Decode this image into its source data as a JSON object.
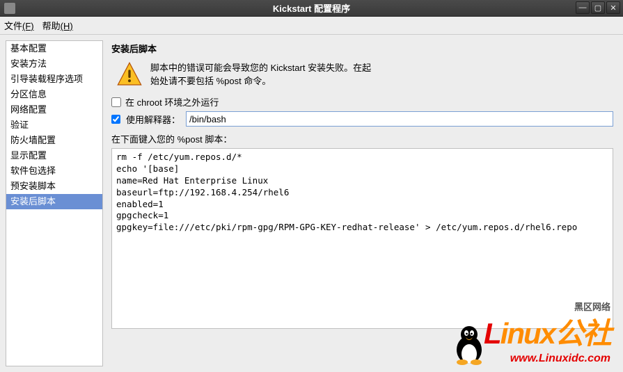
{
  "window": {
    "title": "Kickstart 配置程序"
  },
  "menubar": {
    "file": "文件",
    "file_key": "(F)",
    "help": "帮助",
    "help_key": "(H)"
  },
  "sidebar": {
    "items": [
      {
        "label": "基本配置",
        "selected": false
      },
      {
        "label": "安装方法",
        "selected": false
      },
      {
        "label": "引导装载程序选项",
        "selected": false
      },
      {
        "label": "分区信息",
        "selected": false
      },
      {
        "label": "网络配置",
        "selected": false
      },
      {
        "label": "验证",
        "selected": false
      },
      {
        "label": "防火墙配置",
        "selected": false
      },
      {
        "label": "显示配置",
        "selected": false
      },
      {
        "label": "软件包选择",
        "selected": false
      },
      {
        "label": "预安装脚本",
        "selected": false
      },
      {
        "label": "安装后脚本",
        "selected": true
      }
    ]
  },
  "main": {
    "heading": "安装后脚本",
    "warning_line1": "脚本中的错误可能会导致您的   Kickstart   安装失败。在起",
    "warning_line2": "始处请不要包括  %post 命令。",
    "chroot_label": "在 chroot 环境之外运行",
    "chroot_checked": false,
    "interpreter_label": "使用解释器：",
    "interpreter_checked": true,
    "interpreter_value": "/bin/bash",
    "script_label": "在下面键入您的 %post 脚本：",
    "script_value": "rm -f /etc/yum.repos.d/*\necho '[base]\nname=Red Hat Enterprise Linux\nbaseurl=ftp://192.168.4.254/rhel6\nenabled=1\ngpgcheck=1\ngpgkey=file:///etc/pki/rpm-gpg/RPM-GPG-KEY-redhat-release' > /etc/yum.repos.d/rhel6.repo"
  },
  "watermark": {
    "cn": "黑区网络",
    "logo_l": "L",
    "logo_rest": "inux公社",
    "url": "www.Linuxidc.com"
  }
}
